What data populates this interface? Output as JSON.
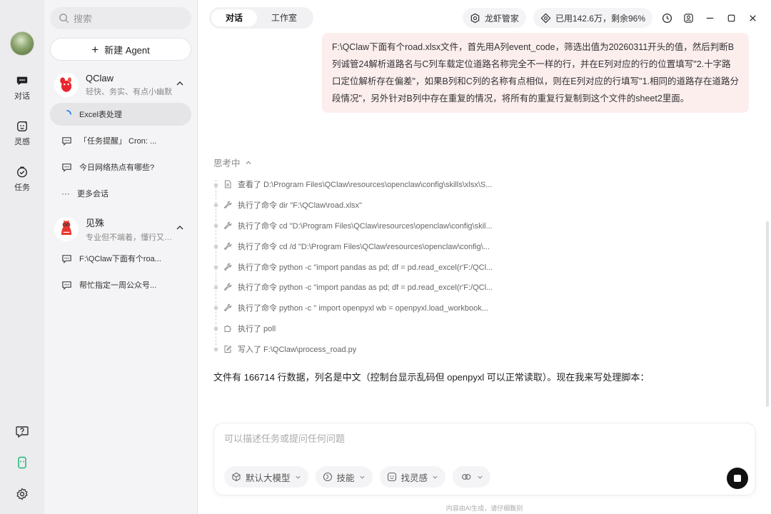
{
  "rail": {
    "items": [
      {
        "label": "对话"
      },
      {
        "label": "灵感"
      },
      {
        "label": "任务"
      }
    ]
  },
  "sidebar": {
    "search_placeholder": "搜索",
    "new_agent_label": "新建 Agent",
    "agents": [
      {
        "name": "QClaw",
        "desc": "轻快、务实、有点小幽默",
        "conversations": [
          {
            "label": "Excel表处理"
          },
          {
            "label": "「任务提醒」 Cron: ..."
          },
          {
            "label": "今日网络热点有哪些?"
          },
          {
            "label": "更多会话"
          }
        ]
      },
      {
        "name": "见殊",
        "desc": "专业但不端着，懂行又接地...",
        "conversations": [
          {
            "label": "F:\\QClaw下面有个roa..."
          },
          {
            "label": "帮忙指定一周公众号..."
          }
        ]
      }
    ]
  },
  "topbar": {
    "tabs": [
      {
        "label": "对话"
      },
      {
        "label": "工作室"
      }
    ],
    "manager_label": "龙虾管家",
    "usage_label": "已用142.6万，剩余96%"
  },
  "chat": {
    "user_message": "F:\\QClaw下面有个road.xlsx文件，首先用A列event_code，筛选出值为20260311开头的值，然后判断B列诚管24解析道路名与C列车载定位道路名称完全不一样的行，并在E列对应的行的位置填写\"2.十字路口定位解析存在偏差\"，如果B列和C列的名称有点相似，则在E列对应的行填写\"1.相同的道路存在道路分段情况\"，另外针对B列中存在重复的情况，将所有的重复行复制到这个文件的sheet2里面。",
    "thinking_label": "思考中",
    "steps": [
      {
        "icon": "file-icon",
        "text": "查看了 D:\\Program Files\\QClaw\\resources\\openclaw\\config\\skills\\xlsx\\S..."
      },
      {
        "icon": "wrench-icon",
        "text": "执行了命令 dir \"F:\\QClaw\\road.xlsx\""
      },
      {
        "icon": "wrench-icon",
        "text": "执行了命令 cd \"D:\\Program Files\\QClaw\\resources\\openclaw\\config\\skil..."
      },
      {
        "icon": "wrench-icon",
        "text": "执行了命令 cd /d \"D:\\Program Files\\QClaw\\resources\\openclaw\\config\\..."
      },
      {
        "icon": "wrench-icon",
        "text": "执行了命令 python -c \"import pandas as pd; df = pd.read_excel(r'F:/QCl..."
      },
      {
        "icon": "wrench-icon",
        "text": "执行了命令 python -c \"import pandas as pd; df = pd.read_excel(r'F:/QCl..."
      },
      {
        "icon": "wrench-icon",
        "text": "执行了命令 python -c \" import openpyxl wb = openpyxl.load_workbook..."
      },
      {
        "icon": "puzzle-icon",
        "text": "执行了 poll"
      },
      {
        "icon": "edit-icon",
        "text": "写入了 F:\\QClaw\\process_road.py"
      }
    ],
    "answer": "文件有 166714 行数据，列名是中文（控制台显示乱码但 openpyxl 可以正常读取）。现在我来写处理脚本："
  },
  "composer": {
    "placeholder": "可以描述任务或提问任何问题",
    "chips": [
      {
        "label": "默认大模型"
      },
      {
        "label": "技能"
      },
      {
        "label": "找灵感"
      }
    ],
    "footer_note": "内容由AI生成，请仔细甄别"
  }
}
